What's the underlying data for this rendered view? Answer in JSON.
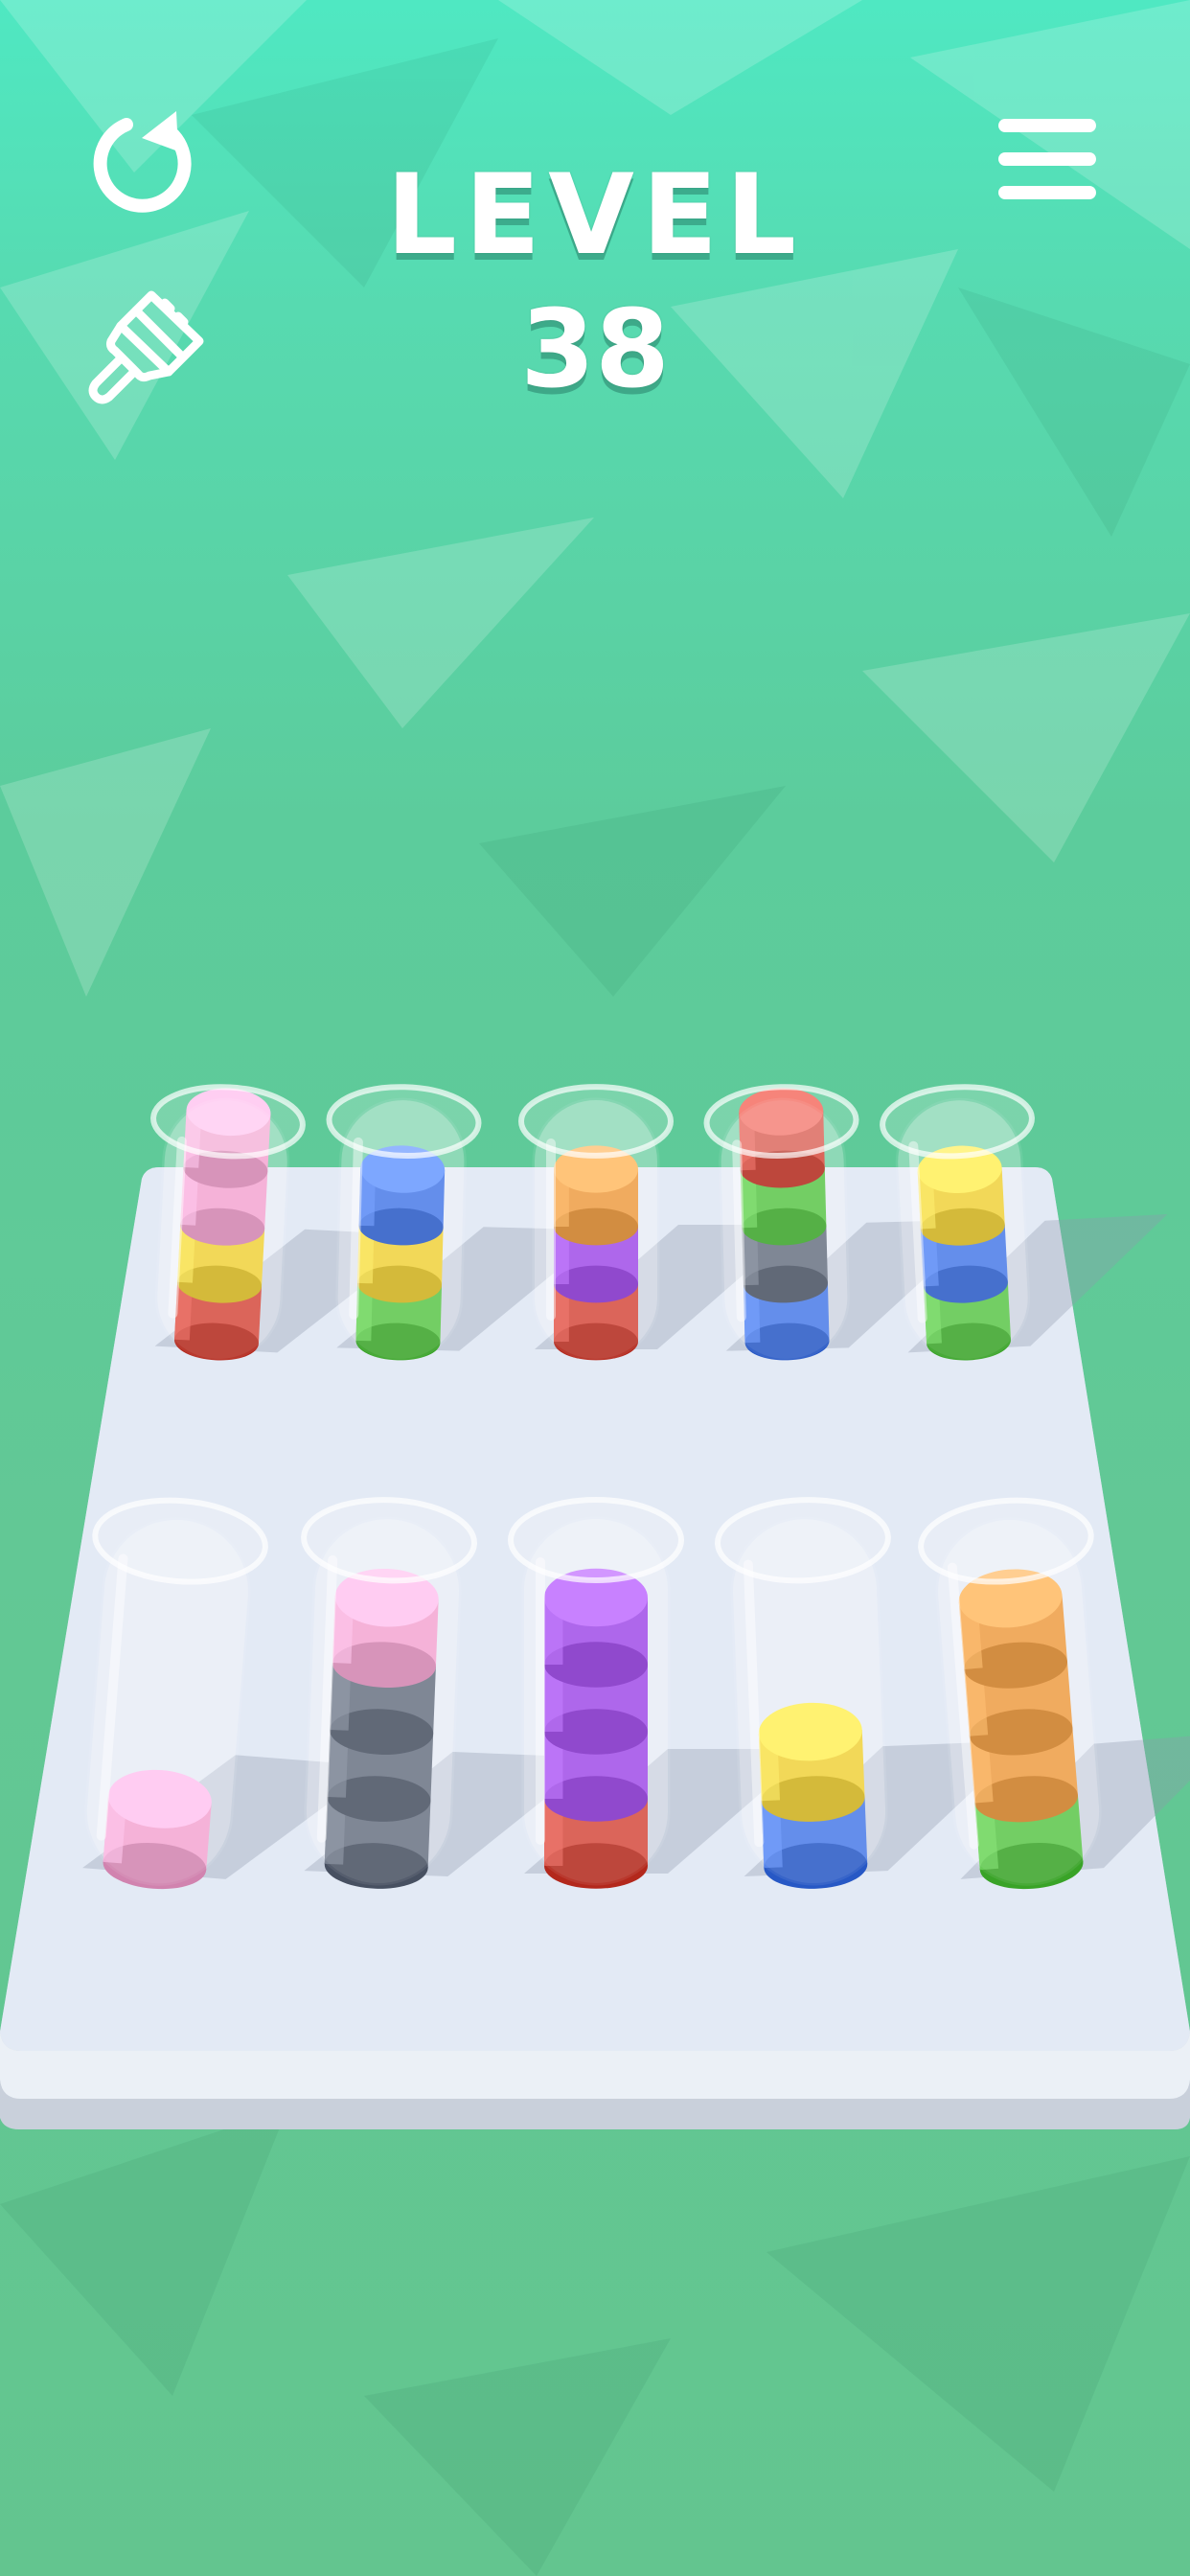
{
  "hud": {
    "level_label": "LEVEL",
    "level_number": "38",
    "restart_icon": "restart-icon",
    "skin_icon": "paintbrush-icon",
    "menu_icon": "hamburger-menu-icon"
  },
  "colors": {
    "background": "#5ccc9c",
    "board": "#dfe8f4",
    "pink": "#f4a6d2",
    "yellow": "#f0d23c",
    "red": "#d64b3f",
    "blue": "#4a7be8",
    "green": "#5cc64a",
    "orange": "#ee9d45",
    "purple": "#a14ee8",
    "gray": "#6a7384"
  },
  "board": {
    "tube_capacity": 4,
    "rows": [
      {
        "tubes": [
          {
            "layers": [
              "red",
              "yellow",
              "pink",
              "pink"
            ]
          },
          {
            "layers": [
              "green",
              "yellow",
              "blue"
            ]
          },
          {
            "layers": [
              "red",
              "purple",
              "orange"
            ]
          },
          {
            "layers": [
              "blue",
              "gray",
              "green",
              "red"
            ]
          },
          {
            "layers": [
              "green",
              "blue",
              "yellow"
            ]
          }
        ]
      },
      {
        "tubes": [
          {
            "layers": [
              "pink"
            ]
          },
          {
            "layers": [
              "gray",
              "gray",
              "gray",
              "pink"
            ]
          },
          {
            "layers": [
              "red",
              "purple",
              "purple",
              "purple"
            ]
          },
          {
            "layers": [
              "blue",
              "yellow"
            ]
          },
          {
            "layers": [
              "green",
              "orange",
              "orange",
              "orange"
            ]
          }
        ]
      }
    ]
  }
}
